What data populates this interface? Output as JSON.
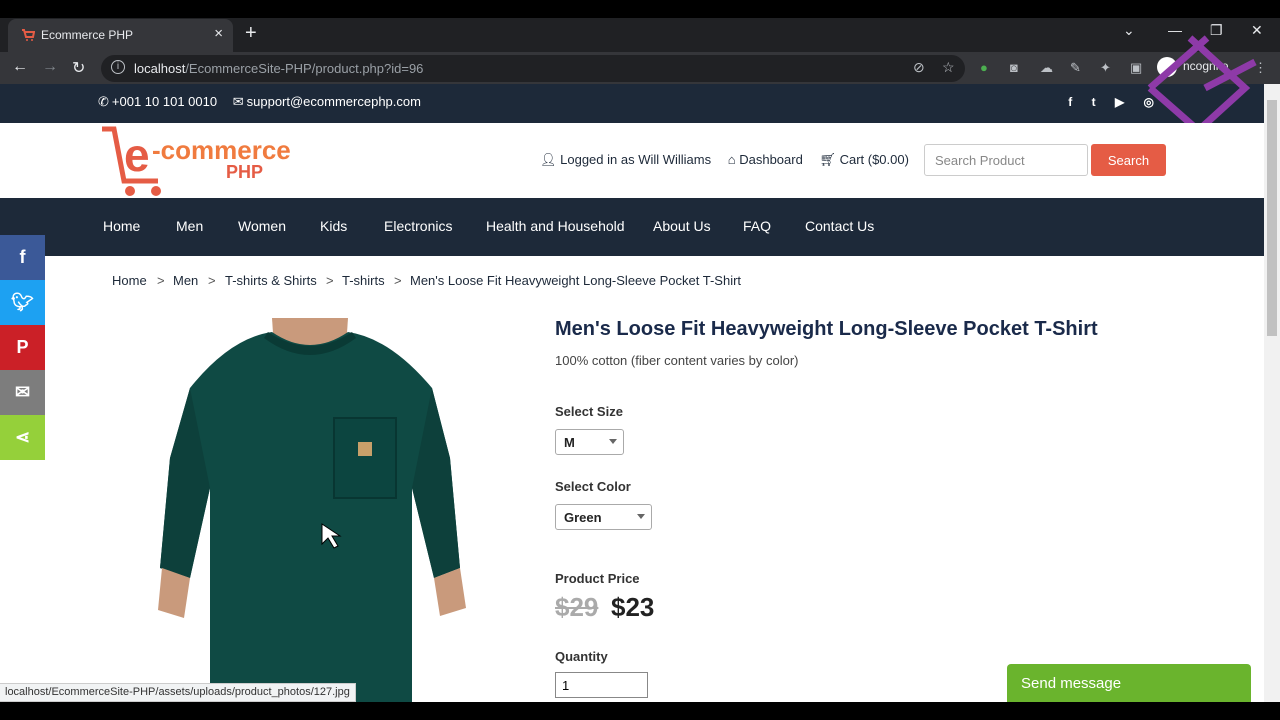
{
  "browser": {
    "tab_title": "Ecommerce PHP",
    "url_host": "localhost",
    "url_path": "/EcommerceSite-PHP/product.php?id=96",
    "profile_label": "ncognito",
    "status_url": "localhost/EcommerceSite-PHP/assets/uploads/product_photos/127.jpg"
  },
  "topbar": {
    "phone": "+001 10 101 0010",
    "email": "support@ecommercephp.com"
  },
  "header": {
    "logo_main": "e-commerce",
    "logo_sub": "PHP",
    "logged_in": "Logged in as Will Williams",
    "dashboard": "Dashboard",
    "cart": "Cart ($0.00)",
    "search_placeholder": "Search Product",
    "search_button": "Search"
  },
  "nav": {
    "items": [
      "Home",
      "Men",
      "Women",
      "Kids",
      "Electronics",
      "Health and Household",
      "About Us",
      "FAQ",
      "Contact Us"
    ]
  },
  "breadcrumb": {
    "items": [
      "Home",
      "Men",
      "T-shirts & Shirts",
      "T-shirts",
      "Men's Loose Fit Heavyweight Long-Sleeve Pocket T-Shirt"
    ],
    "separator": ">"
  },
  "product": {
    "title": "Men's Loose Fit Heavyweight Long-Sleeve Pocket T-Shirt",
    "description": "100% cotton (fiber content varies by color)",
    "size_label": "Select Size",
    "size_value": "M",
    "color_label": "Select Color",
    "color_value": "Green",
    "price_label": "Product Price",
    "old_price": "$29",
    "new_price": "$23",
    "quantity_label": "Quantity",
    "quantity_value": "1"
  },
  "chat": {
    "label": "Send message"
  },
  "colors": {
    "navy": "#1d2939",
    "accent": "#e55c45",
    "shirt": "#0f4a44",
    "chat": "#6ab42d"
  }
}
